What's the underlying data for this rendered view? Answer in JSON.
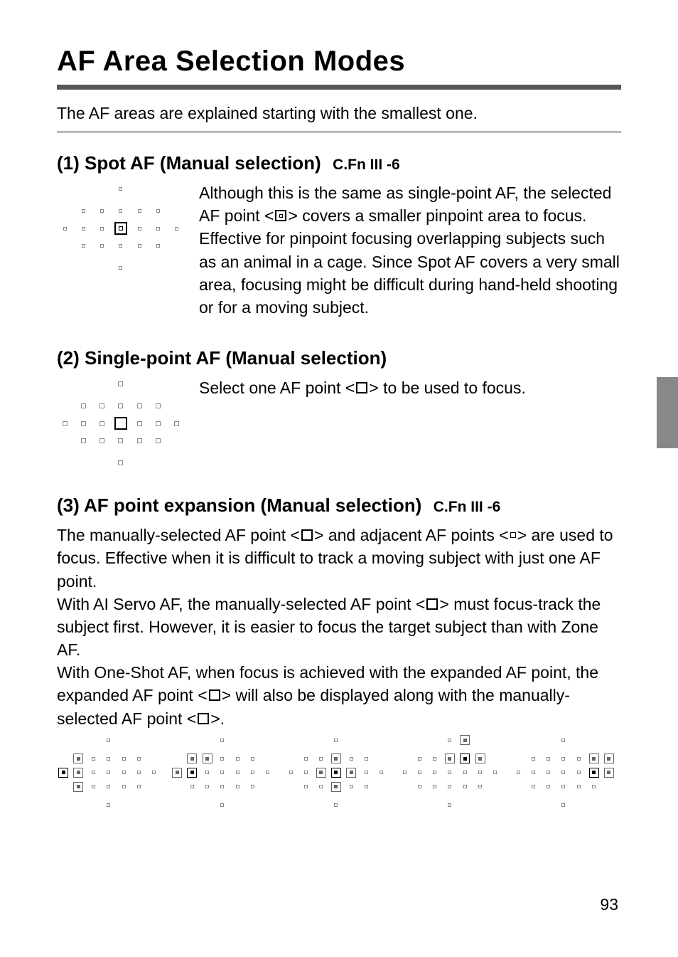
{
  "title": "AF Area Selection Modes",
  "intro": "The AF areas are explained starting with the smallest one.",
  "sections": {
    "spot": {
      "heading": "(1) Spot AF (Manual selection)",
      "badge": "C.Fn III -6",
      "desc_a": "Although this is the same as single-point AF, the selected AF point <",
      "desc_b": "> covers a smaller pinpoint area to focus. Effective for pinpoint focusing overlapping subjects such as an animal in a cage. Since Spot AF covers a very small area, focusing might be difficult during hand-held shooting or for a moving subject."
    },
    "single": {
      "heading": "(2) Single-point AF (Manual selection)",
      "desc_a": "Select one AF point <",
      "desc_b": "> to be used to focus."
    },
    "expansion": {
      "heading": "(3) AF point expansion (Manual selection)",
      "badge": "C.Fn III -6",
      "p1_a": "The manually-selected AF point <",
      "p1_b": "> and adjacent AF points <",
      "p1_c": "> are used to focus. Effective when it is difficult to track a moving subject with just one AF point.",
      "p2_a": "With AI Servo AF, the manually-selected AF point <",
      "p2_b": "> must focus-track the subject first. However, it is easier to focus the target subject than with Zone AF.",
      "p3_a": "With One-Shot AF, when focus is achieved with the expanded AF point, the expanded AF point <",
      "p3_b": "> will also be displayed along with the manually-selected AF point <",
      "p3_c": ">."
    }
  },
  "page_number": "93",
  "diagram_spot": {
    "selected": [
      [
        2,
        3
      ]
    ],
    "selected_style": "inner",
    "points_small": true
  },
  "diagram_single": {
    "selected": [
      [
        2,
        3
      ]
    ],
    "selected_style": "empty",
    "points_small": false
  },
  "diagram_expansion_row": [
    {
      "primary": [
        2,
        0
      ],
      "adjacent": [
        [
          1,
          1
        ],
        [
          2,
          1
        ],
        [
          3,
          1
        ]
      ]
    },
    {
      "primary": [
        2,
        1
      ],
      "adjacent": [
        [
          1,
          1
        ],
        [
          1,
          2
        ],
        [
          2,
          0
        ]
      ]
    },
    {
      "primary": [
        2,
        3
      ],
      "adjacent": [
        [
          1,
          3
        ],
        [
          2,
          2
        ],
        [
          2,
          4
        ],
        [
          3,
          3
        ]
      ]
    },
    {
      "primary": [
        1,
        4
      ],
      "adjacent": [
        [
          0,
          4
        ],
        [
          1,
          3
        ],
        [
          1,
          5
        ]
      ]
    },
    {
      "primary": [
        2,
        5
      ],
      "adjacent": [
        [
          1,
          5
        ],
        [
          1,
          6
        ],
        [
          2,
          6
        ]
      ]
    }
  ],
  "grid_layout": {
    "rows": 5,
    "cols": 7,
    "present": [
      [
        0,
        3
      ],
      [
        1,
        1
      ],
      [
        1,
        2
      ],
      [
        1,
        3
      ],
      [
        1,
        4
      ],
      [
        1,
        5
      ],
      [
        2,
        0
      ],
      [
        2,
        1
      ],
      [
        2,
        2
      ],
      [
        2,
        3
      ],
      [
        2,
        4
      ],
      [
        2,
        5
      ],
      [
        2,
        6
      ],
      [
        3,
        1
      ],
      [
        3,
        2
      ],
      [
        3,
        3
      ],
      [
        3,
        4
      ],
      [
        3,
        5
      ],
      [
        4,
        3
      ]
    ]
  }
}
